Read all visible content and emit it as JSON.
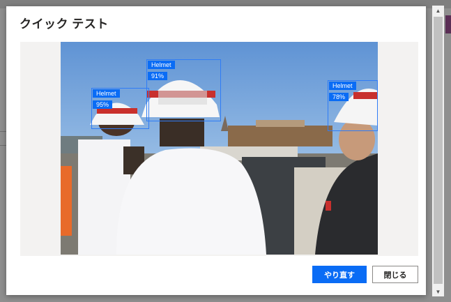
{
  "dialog": {
    "title": "クイック テスト",
    "buttons": {
      "retry_label": "やり直す",
      "close_label": "閉じる"
    }
  },
  "detections": [
    {
      "label": "Helmet",
      "confidence": "95%"
    },
    {
      "label": "Helmet",
      "confidence": "91%"
    },
    {
      "label": "Helmet",
      "confidence": "78%"
    }
  ],
  "colors": {
    "primary": "#0a6cf5",
    "box_border": "#2f7cf6"
  },
  "icons": {
    "scroll_up": "▲",
    "scroll_down": "▼"
  }
}
